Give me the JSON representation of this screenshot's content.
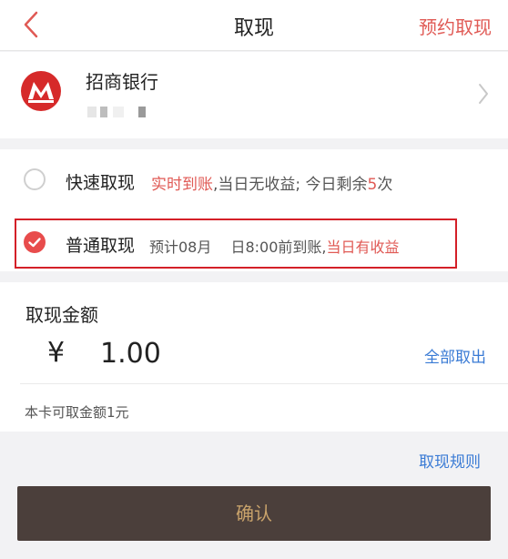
{
  "nav": {
    "title": "取现",
    "right_action": "预约取现"
  },
  "bank": {
    "name": "招商银行"
  },
  "methods": {
    "fast": {
      "label": "快速取现",
      "desc_highlight": "实时到账",
      "desc_text": ",当日无收益; 今日剩余",
      "remaining": "5",
      "remaining_unit": "次",
      "selected": false
    },
    "normal": {
      "label": "普通取现",
      "desc_text": "预计08月　 日8:00前到账,",
      "desc_highlight": "当日有收益",
      "selected": true
    }
  },
  "amount": {
    "label": "取现金额",
    "currency": "¥",
    "value": "1.00",
    "withdraw_all": "全部取出",
    "available": "本卡可取金额1元"
  },
  "rules_link": "取现规则",
  "confirm_label": "确认",
  "colors": {
    "accent_red": "#e05a55",
    "link_blue": "#3a7bd5",
    "confirm_bg": "#4b3f3b",
    "confirm_text": "#c9a36b",
    "highlight_border": "#d42028"
  }
}
